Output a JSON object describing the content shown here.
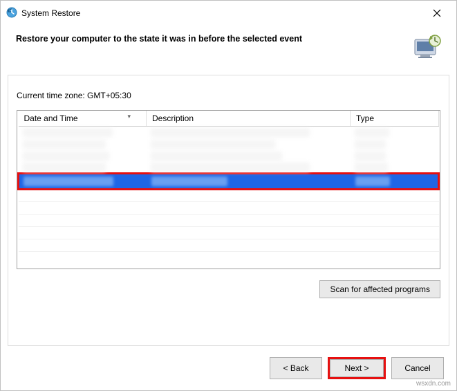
{
  "window": {
    "title": "System Restore"
  },
  "header": {
    "heading": "Restore your computer to the state it was in before the selected event"
  },
  "timezone": {
    "label": "Current time zone: GMT+05:30"
  },
  "table": {
    "columns": {
      "datetime": "Date and Time",
      "description": "Description",
      "type": "Type"
    }
  },
  "buttons": {
    "scan": "Scan for affected programs",
    "back": "< Back",
    "next": "Next >",
    "cancel": "Cancel"
  },
  "watermark": "wsxdn.com"
}
